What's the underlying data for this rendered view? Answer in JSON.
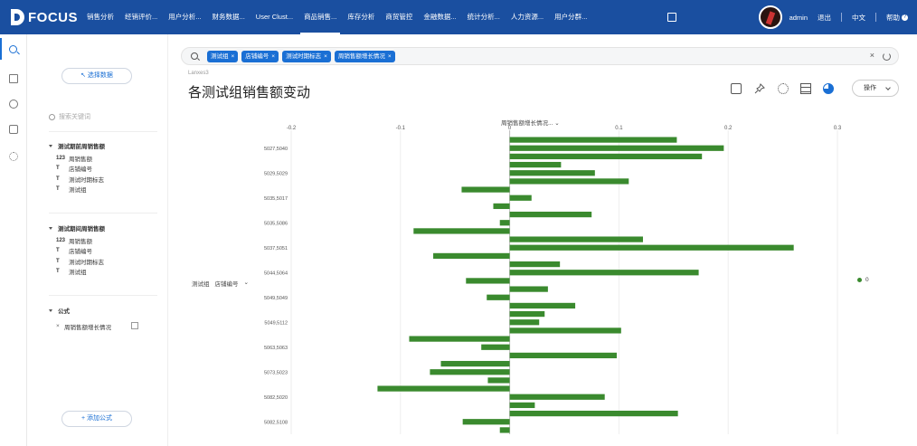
{
  "app": {
    "logo_text": "FOCUS"
  },
  "nav": {
    "items": [
      "销售分析",
      "经销评价...",
      "用户分析...",
      "财务数据...",
      "User Clust...",
      "商品销售...",
      "库存分析",
      "商贸管控",
      "金融数据...",
      "统计分析...",
      "人力资源...",
      "用户分群..."
    ],
    "active_index": 5
  },
  "user": {
    "name": "admin",
    "logout": "退出",
    "language": "中文",
    "help": "帮助",
    "help_icon": "?"
  },
  "sidebar": {
    "select_data_button": "选择数据",
    "search_placeholder": "搜索关键词",
    "tables": [
      {
        "title": "测试期前周销售额",
        "fields": [
          {
            "type": "123",
            "name": "周销售额"
          },
          {
            "type": "T",
            "name": "店铺编号"
          },
          {
            "type": "T",
            "name": "测试时期标志"
          },
          {
            "type": "T",
            "name": "测试组"
          }
        ]
      },
      {
        "title": "测试期间周销售额",
        "fields": [
          {
            "type": "123",
            "name": "周销售额"
          },
          {
            "type": "T",
            "name": "店铺编号"
          },
          {
            "type": "T",
            "name": "测试时期标志"
          },
          {
            "type": "T",
            "name": "测试组"
          }
        ]
      }
    ],
    "formula_section": "公式",
    "formula_item": "周销售额增长情况",
    "add_formula_button": "+ 添加公式"
  },
  "filterbar": {
    "chips": [
      "测试组",
      "店铺编号",
      "测试时期标志",
      "周销售额增长情况"
    ],
    "clear_icon": "×"
  },
  "breadcrumb": "Lanxes3",
  "page_title": "各测试组销售额变动",
  "toolbar": {
    "operation_button": "操作"
  },
  "chart_data": {
    "type": "bar",
    "orientation": "horizontal",
    "x_measure_label": "周销售额增长情况...",
    "y_dimensions": [
      "测试组",
      "店铺编号"
    ],
    "xlim": [
      -0.2,
      0.3
    ],
    "xticks": [
      -0.2,
      -0.1,
      0,
      0.1,
      0.2,
      0.3
    ],
    "tick_labels": [
      "-0.2",
      "-0.1",
      "0",
      "0.1",
      "0.2",
      "0.3"
    ],
    "category_labels": [
      "5027,5040",
      "5029,5029",
      "5035,5017",
      "5035,5086",
      "5037,5051",
      "5044,5064",
      "5049,5049",
      "5049,5112",
      "5063,5063",
      "5073,5023",
      "5082,5020",
      "5082,5108"
    ],
    "label_every": 3,
    "label_offset": 1,
    "values": [
      0.153,
      0.196,
      0.176,
      0.047,
      0.078,
      0.109,
      -0.044,
      0.02,
      -0.015,
      0.075,
      -0.009,
      -0.088,
      0.122,
      0.26,
      -0.07,
      0.046,
      0.173,
      -0.04,
      0.035,
      -0.021,
      0.06,
      0.032,
      0.027,
      0.102,
      -0.092,
      -0.026,
      0.098,
      -0.063,
      -0.073,
      -0.02,
      -0.121,
      0.087,
      0.023,
      0.154,
      -0.043,
      -0.009
    ],
    "series": [
      {
        "name": "0",
        "color": "#3a8a2e"
      }
    ],
    "legend_position": "right",
    "grid": true
  }
}
